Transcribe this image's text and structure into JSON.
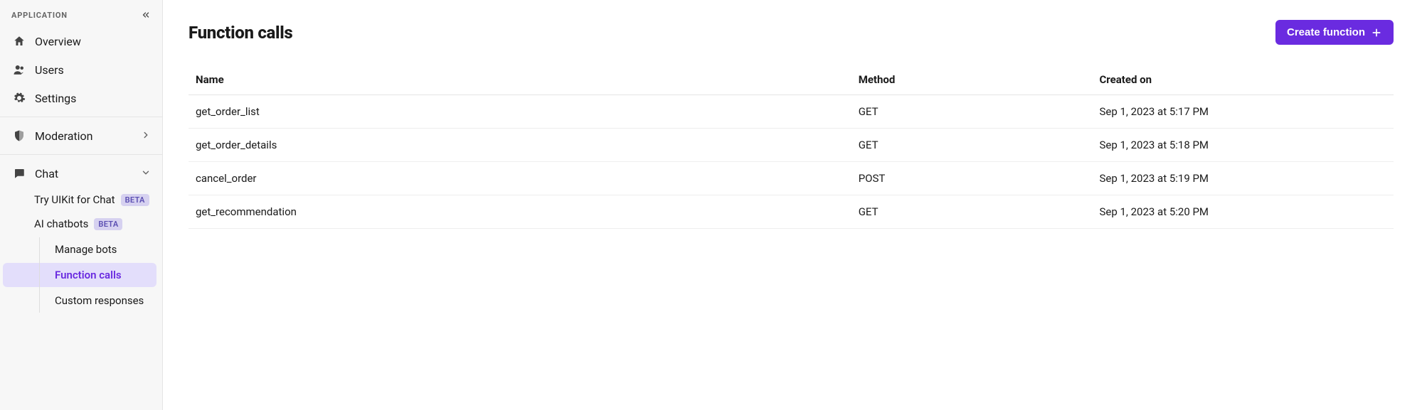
{
  "sidebar": {
    "header": "APPLICATION",
    "items": [
      {
        "label": "Overview"
      },
      {
        "label": "Users"
      },
      {
        "label": "Settings"
      },
      {
        "label": "Moderation"
      },
      {
        "label": "Chat"
      }
    ],
    "chat_sub": [
      {
        "label": "Try UIKit for Chat",
        "badge": "BETA"
      },
      {
        "label": "AI chatbots",
        "badge": "BETA"
      }
    ],
    "chatbot_sub": [
      {
        "label": "Manage bots"
      },
      {
        "label": "Function calls"
      },
      {
        "label": "Custom responses"
      }
    ]
  },
  "page": {
    "title": "Function calls",
    "create_button": "Create function"
  },
  "table": {
    "headers": {
      "name": "Name",
      "method": "Method",
      "created": "Created on"
    },
    "rows": [
      {
        "name": "get_order_list",
        "method": "GET",
        "created": "Sep 1, 2023 at 5:17 PM"
      },
      {
        "name": "get_order_details",
        "method": "GET",
        "created": "Sep 1, 2023 at 5:18 PM"
      },
      {
        "name": "cancel_order",
        "method": "POST",
        "created": "Sep 1, 2023 at 5:19 PM"
      },
      {
        "name": "get_recommendation",
        "method": "GET",
        "created": "Sep 1, 2023 at 5:20 PM"
      }
    ]
  }
}
